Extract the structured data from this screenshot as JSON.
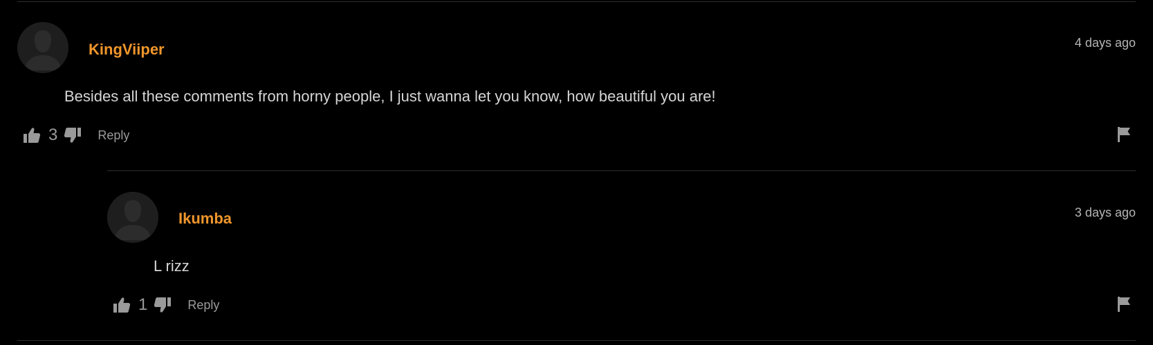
{
  "comments": [
    {
      "username": "KingViiper",
      "timestamp": "4 days ago",
      "text": "Besides all these comments from horny people, I just wanna let you know, how beautiful you are!",
      "likes": "3",
      "reply_label": "Reply",
      "avatar_icon": "default-user-avatar",
      "like_icon": "thumbs-up-icon",
      "dislike_icon": "thumbs-down-icon",
      "flag_icon": "flag-icon"
    },
    {
      "username": "Ikumba",
      "timestamp": "3 days ago",
      "text": "L rizz",
      "likes": "1",
      "reply_label": "Reply",
      "avatar_icon": "default-user-avatar",
      "like_icon": "thumbs-up-icon",
      "dislike_icon": "thumbs-down-icon",
      "flag_icon": "flag-icon"
    }
  ],
  "colors": {
    "background": "#000000",
    "username": "#f0962c",
    "body_text": "#d6d6d6",
    "muted": "#9a9a9a",
    "timestamp": "#b5b5b5",
    "divider": "#2e2e2e",
    "avatar_bg": "#1e1e1e",
    "avatar_figure": "#2c2c2c"
  }
}
